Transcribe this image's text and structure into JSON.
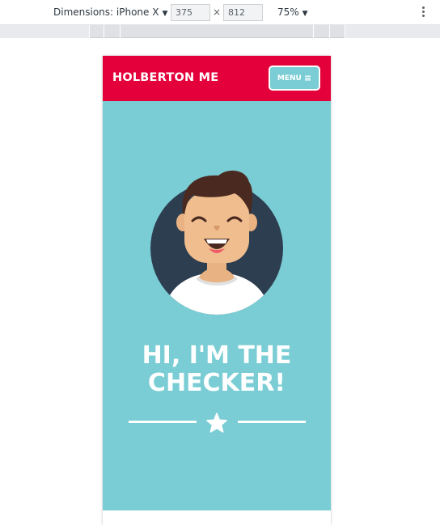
{
  "devtools": {
    "dimensions_label": "Dimensions: iPhone X",
    "width_value": "375",
    "height_value": "812",
    "times_symbol": "×",
    "zoom_label": "75%",
    "dropdown_icon": "triangle-down-icon",
    "more_icon": "kebab-menu-icon"
  },
  "site": {
    "brand": "HOLBERTON ME",
    "menu_label": "MENU",
    "menu_icon": "hamburger-icon",
    "hero_title": "HI, I'M THE\nCHECKER!",
    "hero_icon": "star-icon",
    "avatar_icon": "smiling-person-avatar-icon"
  },
  "colors": {
    "header_red": "#e4003a",
    "hero_teal": "#7acdd4",
    "avatar_circle": "#2d3e50",
    "text_white": "#ffffff"
  }
}
